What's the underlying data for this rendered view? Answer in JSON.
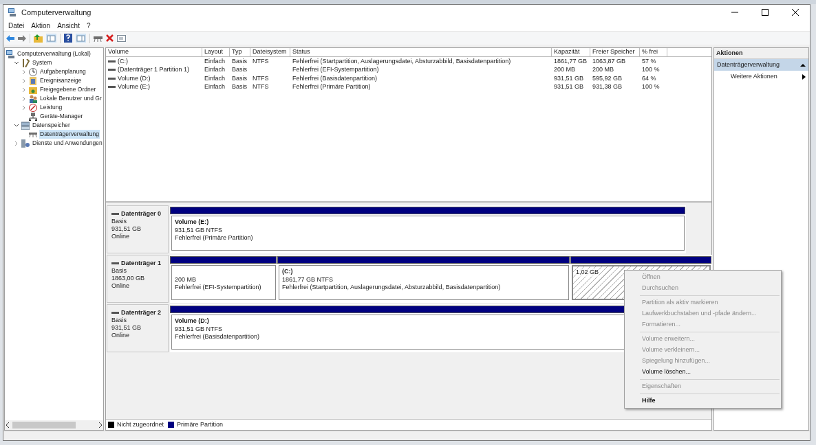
{
  "window": {
    "title": "Computerverwaltung"
  },
  "menu": [
    "Datei",
    "Aktion",
    "Ansicht",
    "?"
  ],
  "tree": [
    {
      "label": "Computerverwaltung (Lokal)",
      "selected": false,
      "children": [
        {
          "label": "System",
          "selected": false,
          "expanded": true,
          "children": [
            {
              "label": "Aufgabenplanung",
              "selected": false,
              "expanded": false
            },
            {
              "label": "Ereignisanzeige",
              "selected": false,
              "expanded": false
            },
            {
              "label": "Freigegebene Ordner",
              "selected": false,
              "expanded": false
            },
            {
              "label": "Lokale Benutzer und Gr",
              "selected": false,
              "expanded": false
            },
            {
              "label": "Leistung",
              "selected": false,
              "expanded": false
            },
            {
              "label": "Geräte-Manager",
              "selected": false
            }
          ]
        },
        {
          "label": "Datenspeicher",
          "selected": false,
          "expanded": true,
          "children": [
            {
              "label": "Datenträgerverwaltung",
              "selected": true
            }
          ]
        },
        {
          "label": "Dienste und Anwendungen",
          "selected": false,
          "expanded": false
        }
      ]
    }
  ],
  "table": {
    "columns": [
      "Volume",
      "Layout",
      "Typ",
      "Dateisystem",
      "Status",
      "Kapazität",
      "Freier Speicher",
      "% frei"
    ],
    "rows": [
      [
        "(C:)",
        "Einfach",
        "Basis",
        "NTFS",
        "Fehlerfrei (Startpartition, Auslagerungsdatei, Absturzabbild, Basisdatenpartition)",
        "1861,77 GB",
        "1063,87 GB",
        "57 %"
      ],
      [
        "(Datenträger 1 Partition 1)",
        "Einfach",
        "Basis",
        "",
        "Fehlerfrei (EFI-Systempartition)",
        "200 MB",
        "200 MB",
        "100 %"
      ],
      [
        "Volume (D:)",
        "Einfach",
        "Basis",
        "NTFS",
        "Fehlerfrei (Basisdatenpartition)",
        "931,51 GB",
        "595,92 GB",
        "64 %"
      ],
      [
        "Volume (E:)",
        "Einfach",
        "Basis",
        "NTFS",
        "Fehlerfrei (Primäre Partition)",
        "931,51 GB",
        "931,38 GB",
        "100 %"
      ]
    ]
  },
  "disks": [
    {
      "name": "Datenträger 0",
      "type": "Basis",
      "size": "931,51 GB",
      "state": "Online",
      "partitions": [
        {
          "title": "Volume  (E:)",
          "lines": [
            "931,51 GB NTFS",
            "Fehlerfrei (Primäre Partition)"
          ],
          "selected": false
        }
      ]
    },
    {
      "name": "Datenträger 1",
      "type": "Basis",
      "size": "1863,00 GB",
      "state": "Online",
      "partitions": [
        {
          "lines": [
            "200 MB",
            "Fehlerfrei (EFI-Systempartition)"
          ],
          "selected": false
        },
        {
          "title": "(C:)",
          "lines": [
            "1861,77 GB NTFS",
            "Fehlerfrei (Startpartition, Auslagerungsdatei, Absturzabbild, Basisdatenpartition)"
          ],
          "selected": false
        },
        {
          "lines": [
            "1,02 GB"
          ],
          "selected": true
        }
      ]
    },
    {
      "name": "Datenträger 2",
      "type": "Basis",
      "size": "931,51 GB",
      "state": "Online",
      "partitions": [
        {
          "title": "Volume  (D:)",
          "lines": [
            "931,51 GB NTFS",
            "Fehlerfrei (Basisdatenpartition)"
          ],
          "selected": false
        }
      ]
    }
  ],
  "legend": [
    {
      "label": "Nicht zugeordnet",
      "color": "#000000"
    },
    {
      "label": "Primäre Partition",
      "color": "#000080"
    }
  ],
  "actions": {
    "title": "Aktionen",
    "section": {
      "label": "Datenträgerverwaltung",
      "expanded": true
    },
    "items": [
      {
        "label": "Weitere Aktionen"
      }
    ]
  },
  "context_menu": [
    [
      {
        "label": "Öffnen",
        "disabled": true,
        "bold": false
      },
      {
        "label": "Durchsuchen",
        "disabled": true,
        "bold": false
      }
    ],
    [
      {
        "label": "Partition als aktiv markieren",
        "disabled": true,
        "bold": false
      },
      {
        "label": "Laufwerkbuchstaben und -pfade ändern...",
        "disabled": true,
        "bold": false
      },
      {
        "label": "Formatieren...",
        "disabled": true,
        "bold": false
      }
    ],
    [
      {
        "label": "Volume erweitern...",
        "disabled": true,
        "bold": false
      },
      {
        "label": "Volume verkleinern...",
        "disabled": true,
        "bold": false
      },
      {
        "label": "Spiegelung hinzufügen...",
        "disabled": true,
        "bold": false
      },
      {
        "label": "Volume löschen...",
        "disabled": false,
        "bold": false
      }
    ],
    [
      {
        "label": "Eigenschaften",
        "disabled": true,
        "bold": false
      }
    ],
    [
      {
        "label": "Hilfe",
        "disabled": false,
        "bold": true
      }
    ]
  ]
}
